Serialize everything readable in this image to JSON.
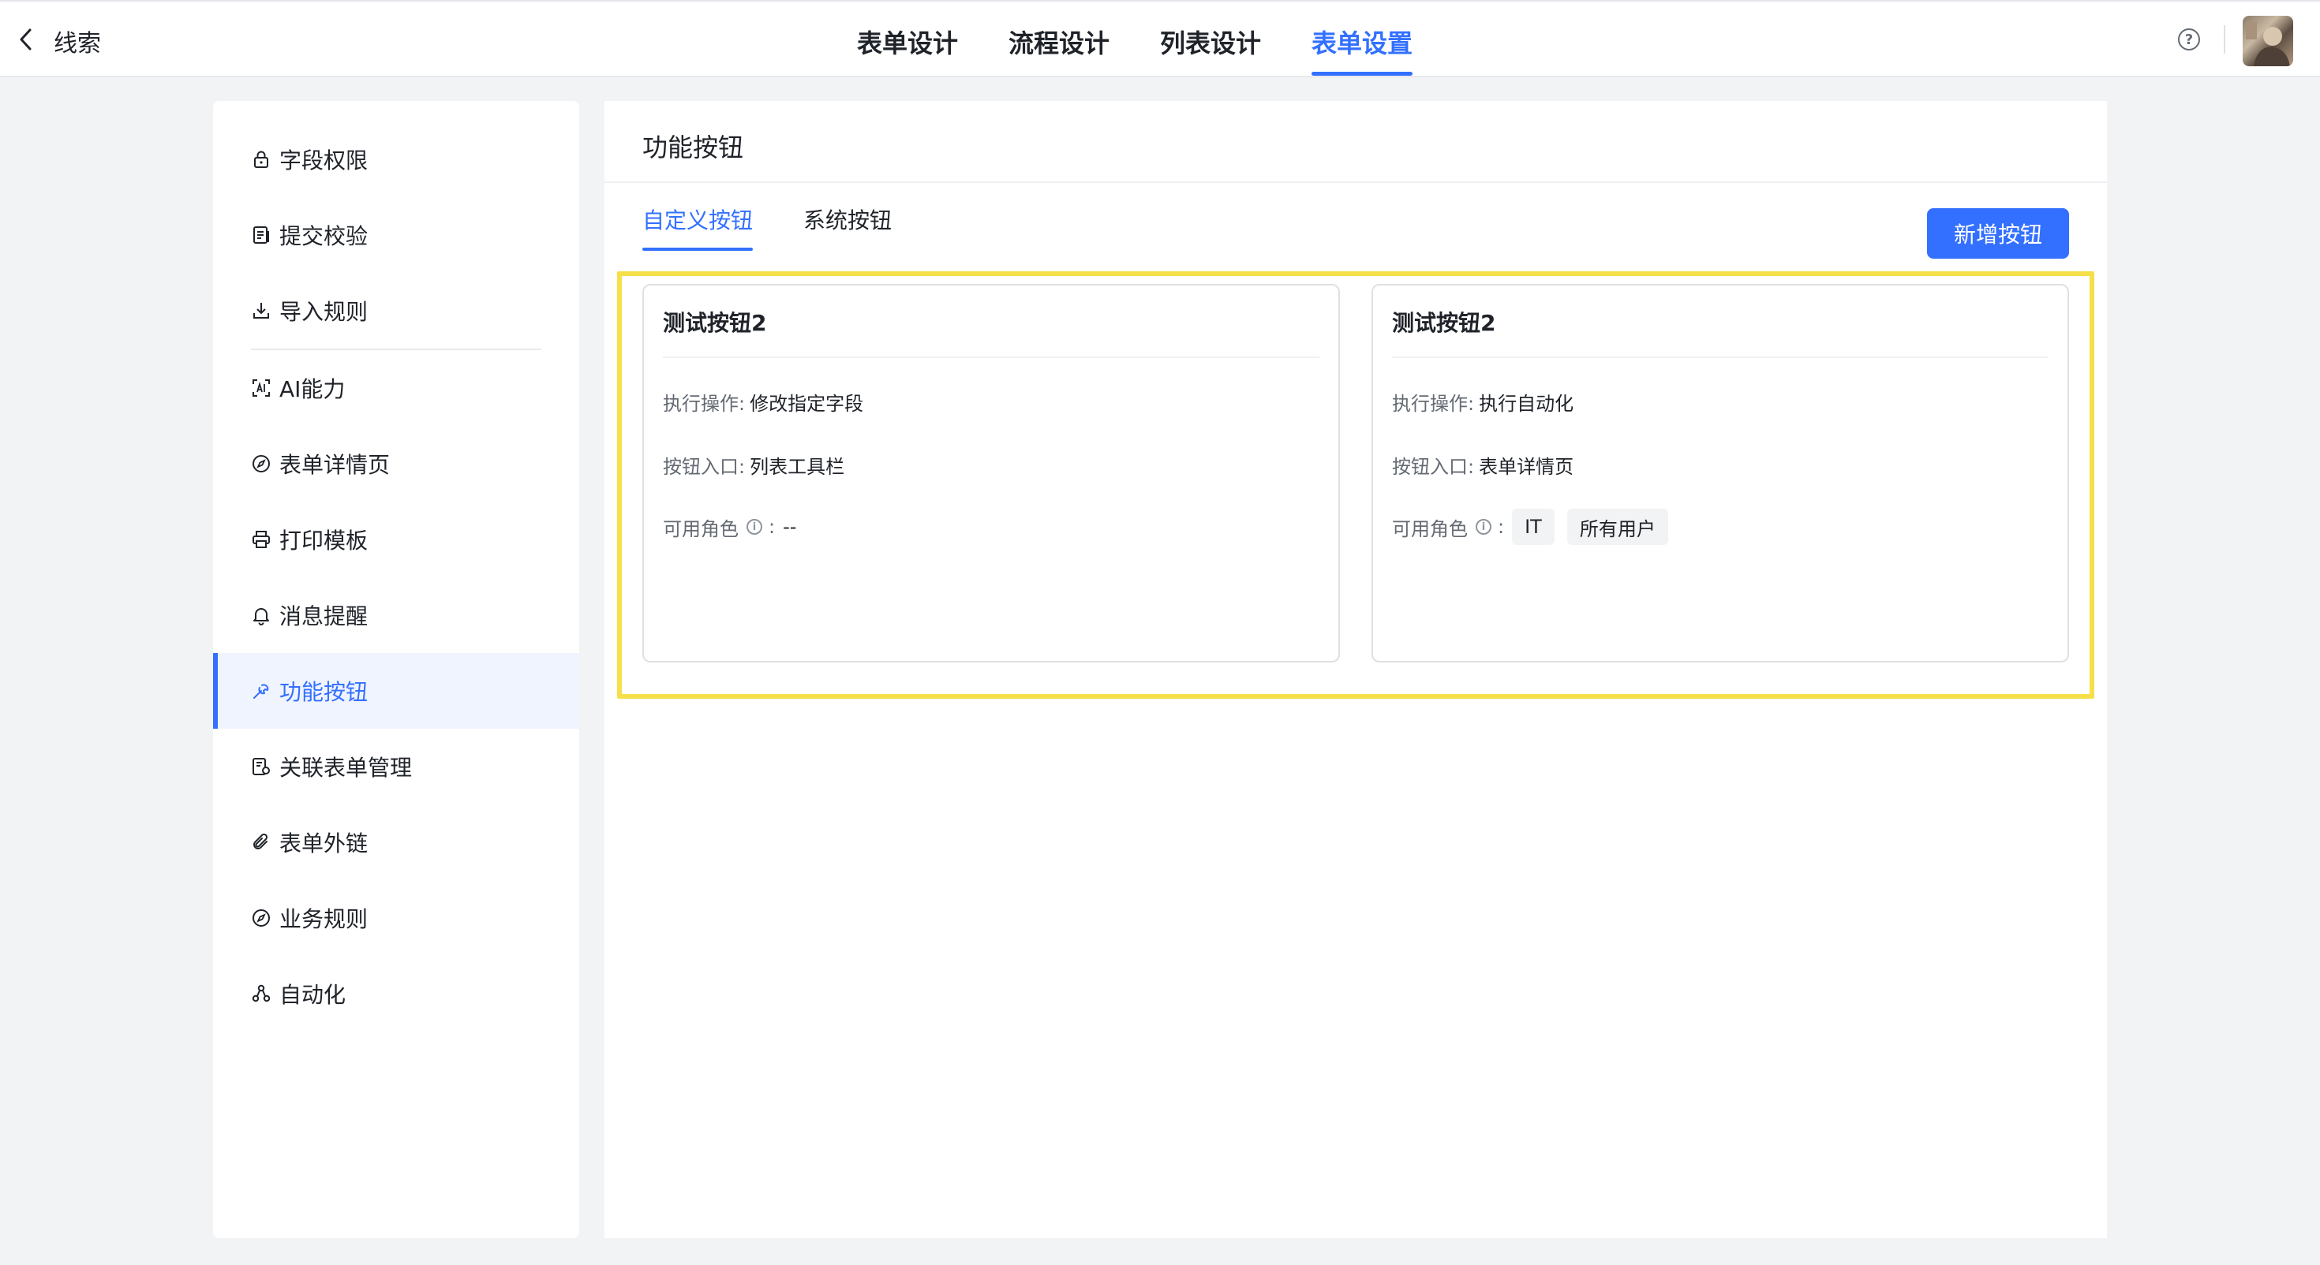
{
  "header": {
    "back_label": "线索",
    "tabs": [
      {
        "label": "表单设计",
        "active": false
      },
      {
        "label": "流程设计",
        "active": false
      },
      {
        "label": "列表设计",
        "active": false
      },
      {
        "label": "表单设置",
        "active": true
      }
    ],
    "help_glyph": "?"
  },
  "sidebar": {
    "items": [
      {
        "label": "字段权限",
        "icon": "lock-icon"
      },
      {
        "label": "提交校验",
        "icon": "checklist-icon"
      },
      {
        "label": "导入规则",
        "icon": "download-icon"
      },
      {
        "label": "AI能力",
        "icon": "ai-scan-icon"
      },
      {
        "label": "表单详情页",
        "icon": "compass-icon"
      },
      {
        "label": "打印模板",
        "icon": "printer-icon"
      },
      {
        "label": "消息提醒",
        "icon": "bell-icon"
      },
      {
        "label": "功能按钮",
        "icon": "wrench-icon",
        "active": true
      },
      {
        "label": "关联表单管理",
        "icon": "form-link-icon"
      },
      {
        "label": "表单外链",
        "icon": "paperclip-icon"
      },
      {
        "label": "业务规则",
        "icon": "compass-icon"
      },
      {
        "label": "自动化",
        "icon": "nodes-icon"
      }
    ]
  },
  "main": {
    "title": "功能按钮",
    "subtabs": [
      {
        "label": "自定义按钮",
        "active": true
      },
      {
        "label": "系统按钮",
        "active": false
      }
    ],
    "add_button_label": "新增按钮",
    "cards": [
      {
        "title": "测试按钮2",
        "action_key": "执行操作:",
        "action_value": "修改指定字段",
        "entry_key": "按钮入口:",
        "entry_value": "列表工具栏",
        "roles_key": "可用角色",
        "roles_colon": ":",
        "roles_value": "--"
      },
      {
        "title": "测试按钮2",
        "action_key": "执行操作:",
        "action_value": "执行自动化",
        "entry_key": "按钮入口:",
        "entry_value": "表单详情页",
        "roles_key": "可用角色",
        "roles_colon": ":",
        "roles_tags": [
          "IT",
          "所有用户"
        ]
      }
    ],
    "info_glyph": "i"
  },
  "colors": {
    "accent": "#3370ff",
    "highlight_border": "#f5e04a",
    "page_background": "#f2f3f5"
  }
}
